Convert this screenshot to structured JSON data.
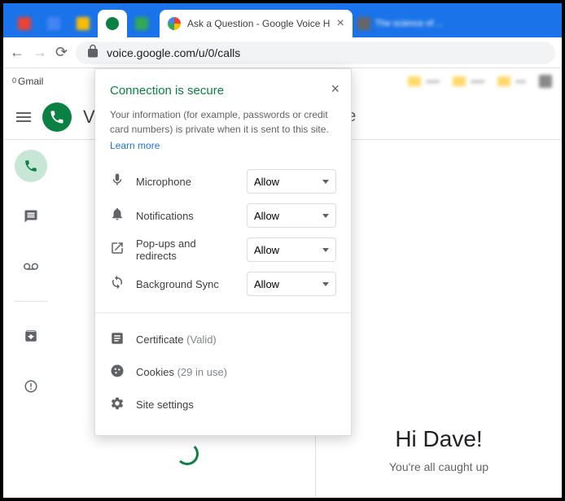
{
  "tabs": {
    "title": "Ask a Question - Google Voice H",
    "other": "The science of ..."
  },
  "url": "voice.google.com/u/0/calls",
  "bookmarks": {
    "gmail": "Gmail",
    "gmail_badge": "0"
  },
  "header": {
    "voice": "le Voice"
  },
  "popup": {
    "title": "Connection is secure",
    "desc": "Your information (for example, passwords or credit card numbers) is private when it is sent to this site.",
    "learn": "Learn more",
    "perms": {
      "mic": "Microphone",
      "notif": "Notifications",
      "popups": "Pop-ups and redirects",
      "sync": "Background Sync",
      "allow": "Allow"
    },
    "cert": {
      "label": "Certificate",
      "status": "(Valid)"
    },
    "cookies": {
      "label": "Cookies",
      "status": "(29 in use)"
    },
    "settings": "Site settings"
  },
  "main": {
    "greeting": "Hi Dave!",
    "sub": "You're all caught up"
  }
}
